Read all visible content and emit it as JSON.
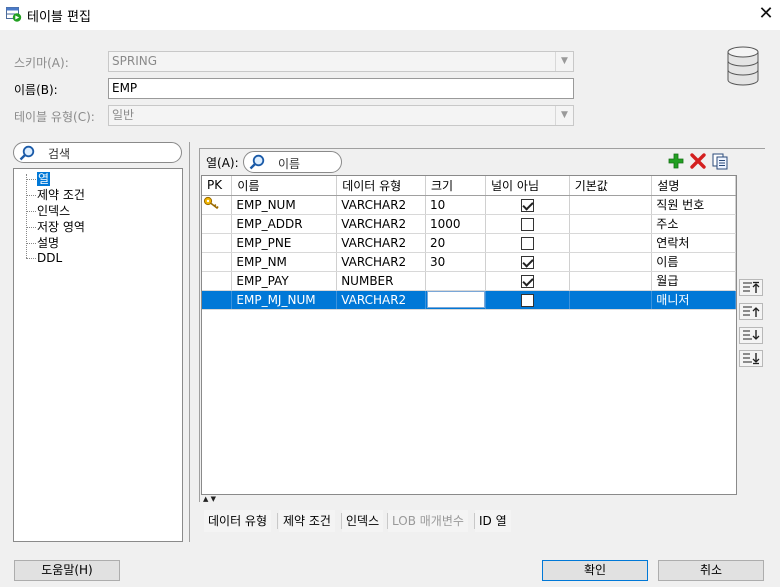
{
  "window": {
    "title": "테이블 편집",
    "close_glyph": "✕"
  },
  "form": {
    "schema_label": "스키마(A):",
    "schema_value": "SPRING",
    "name_label": "이름(B):",
    "name_value": "EMP",
    "type_label": "테이블 유형(C):",
    "type_value": "일반"
  },
  "nav": {
    "search_placeholder": "검색",
    "items": [
      "열",
      "제약 조건",
      "인덱스",
      "저장 영역",
      "설명",
      "DDL"
    ]
  },
  "columns_panel": {
    "label": "열(A):",
    "search_placeholder": "이름",
    "headers": [
      "PK",
      "이름",
      "데이터 유형",
      "크기",
      "널이 아님",
      "기본값",
      "설명"
    ],
    "rows": [
      {
        "pk": true,
        "name": "EMP_NUM",
        "type": "VARCHAR2",
        "size": "10",
        "not_null": true,
        "default": "",
        "desc": "직원 번호"
      },
      {
        "pk": false,
        "name": "EMP_ADDR",
        "type": "VARCHAR2",
        "size": "1000",
        "not_null": false,
        "default": "",
        "desc": "주소"
      },
      {
        "pk": false,
        "name": "EMP_PNE",
        "type": "VARCHAR2",
        "size": "20",
        "not_null": false,
        "default": "",
        "desc": "연락처"
      },
      {
        "pk": false,
        "name": "EMP_NM",
        "type": "VARCHAR2",
        "size": "30",
        "not_null": true,
        "default": "",
        "desc": "이름"
      },
      {
        "pk": false,
        "name": "EMP_PAY",
        "type": "NUMBER",
        "size": "",
        "not_null": true,
        "default": "",
        "desc": "월급"
      },
      {
        "pk": false,
        "name": "EMP_MJ_NUM",
        "type": "VARCHAR2",
        "size": "",
        "not_null": false,
        "default": "",
        "desc": "매니저"
      }
    ],
    "selected_row": 5,
    "toolbar_icons": [
      "add-icon",
      "delete-icon",
      "copy-icon"
    ],
    "side_icons": [
      "move-top-icon",
      "move-up-icon",
      "move-down-icon",
      "move-bottom-icon"
    ]
  },
  "bottom_tabs": [
    {
      "label": "데이터 유형",
      "enabled": true
    },
    {
      "label": "제약 조건",
      "enabled": true
    },
    {
      "label": "인덱스",
      "enabled": true
    },
    {
      "label": "LOB 매개변수",
      "enabled": false
    },
    {
      "label": "ID 열",
      "enabled": true
    }
  ],
  "buttons": {
    "help": "도움말(H)",
    "ok": "확인",
    "cancel": "취소"
  },
  "colors": {
    "selection": "#0078d7",
    "add": "#22a022",
    "delete": "#d42020"
  }
}
